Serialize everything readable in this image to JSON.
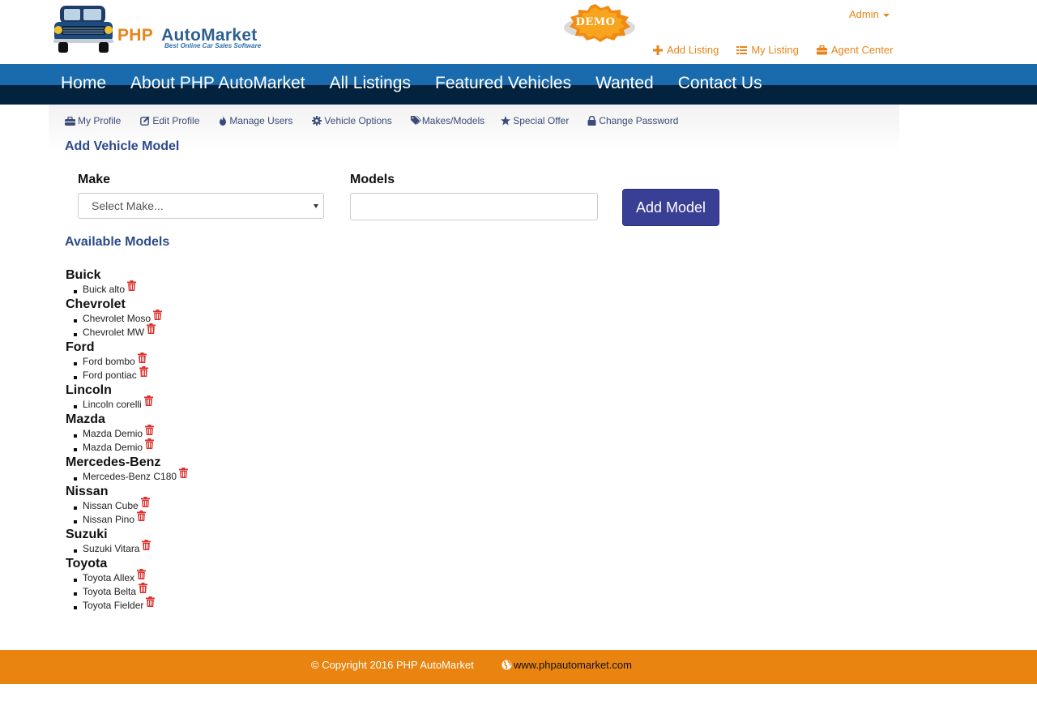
{
  "header": {
    "logo_php": "PHP",
    "logo_automarket": "AutoMarket",
    "logo_tagline": "Best Online Car Sales Software",
    "demo_badge": "DEMO",
    "admin_label": "Admin",
    "top_links": {
      "add_listing": "Add Listing",
      "my_listing": "My Listing",
      "agent_center": "Agent Center"
    }
  },
  "nav": {
    "home": "Home",
    "about": "About PHP AutoMarket",
    "all_listings": "All Listings",
    "featured": "Featured Vehicles",
    "wanted": "Wanted",
    "contact": "Contact Us"
  },
  "subnav": {
    "my_profile": "My Profile",
    "edit_profile": "Edit Profile",
    "manage_users": "Manage Users",
    "vehicle_options": "Vehicle Options",
    "makes_models": "Makes/Models",
    "special_offer": "Special Offer",
    "change_password": "Change Password"
  },
  "form": {
    "title": "Add Vehicle Model",
    "make_label": "Make",
    "make_selected": "Select Make...",
    "models_label": "Models",
    "models_value": "",
    "submit_label": "Add Model"
  },
  "available": {
    "title": "Available Models",
    "makes": [
      {
        "name": "Buick",
        "models": [
          "Buick alto"
        ]
      },
      {
        "name": "Chevrolet",
        "models": [
          "Chevrolet Moso",
          "Chevrolet MW"
        ]
      },
      {
        "name": "Ford",
        "models": [
          "Ford bombo",
          "Ford pontiac"
        ]
      },
      {
        "name": "Lincoln",
        "models": [
          "Lincoln corelli"
        ]
      },
      {
        "name": "Mazda",
        "models": [
          "Mazda Demio",
          "Mazda Demio"
        ]
      },
      {
        "name": "Mercedes-Benz",
        "models": [
          "Mercedes-Benz C180"
        ]
      },
      {
        "name": "Nissan",
        "models": [
          "Nissan Cube",
          "Nissan Pino"
        ]
      },
      {
        "name": "Suzuki",
        "models": [
          "Suzuki Vitara"
        ]
      },
      {
        "name": "Toyota",
        "models": [
          "Toyota Allex",
          "Toyota Belta",
          "Toyota Fielder"
        ]
      }
    ]
  },
  "footer": {
    "copyright": "© Copyright 2016 PHP AutoMarket",
    "website": "www.phpautomarket.com"
  },
  "colors": {
    "brand_orange": "#e8841a",
    "nav_blue": "#1a6bad",
    "nav_dark": "#02223d",
    "button": "#3a3f96",
    "trash_red": "#d9302c",
    "footer": "#e8840f"
  }
}
